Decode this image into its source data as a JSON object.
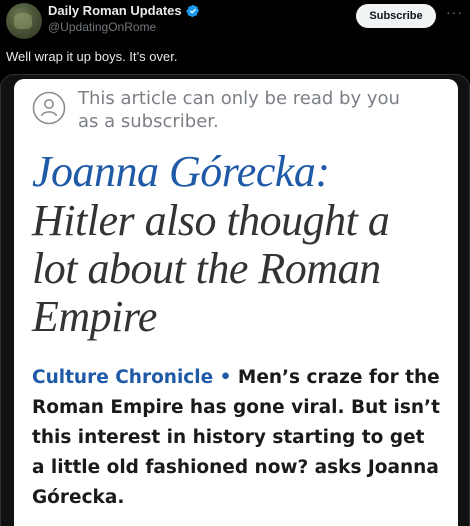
{
  "author": {
    "display_name": "Daily Roman Updates",
    "handle": "@UpdatingOnRome",
    "verified_icon": "verified-badge-icon"
  },
  "actions": {
    "subscribe_label": "Subscribe",
    "more_icon": "more-horizontal-icon"
  },
  "tweet": {
    "text": "Well wrap it up boys. It’s over."
  },
  "article": {
    "notice": "This article can only be read by you as a subscriber.",
    "notice_icon": "person-icon",
    "title_name": "Joanna Górecka:",
    "title_rest": "Hitler also thought a lot about the Roman Empire",
    "section": "Culture Chronicle",
    "separator": "•",
    "lede": "Men’s craze for the Roman Empire has gone viral. But isn’t this interest in history starting to get a little old fashioned now? asks Joanna Górecka."
  },
  "colors": {
    "background": "#000000",
    "card": "#ffffff",
    "accent_blue": "#1f5aa6",
    "verified_blue": "#1d9bf0"
  }
}
